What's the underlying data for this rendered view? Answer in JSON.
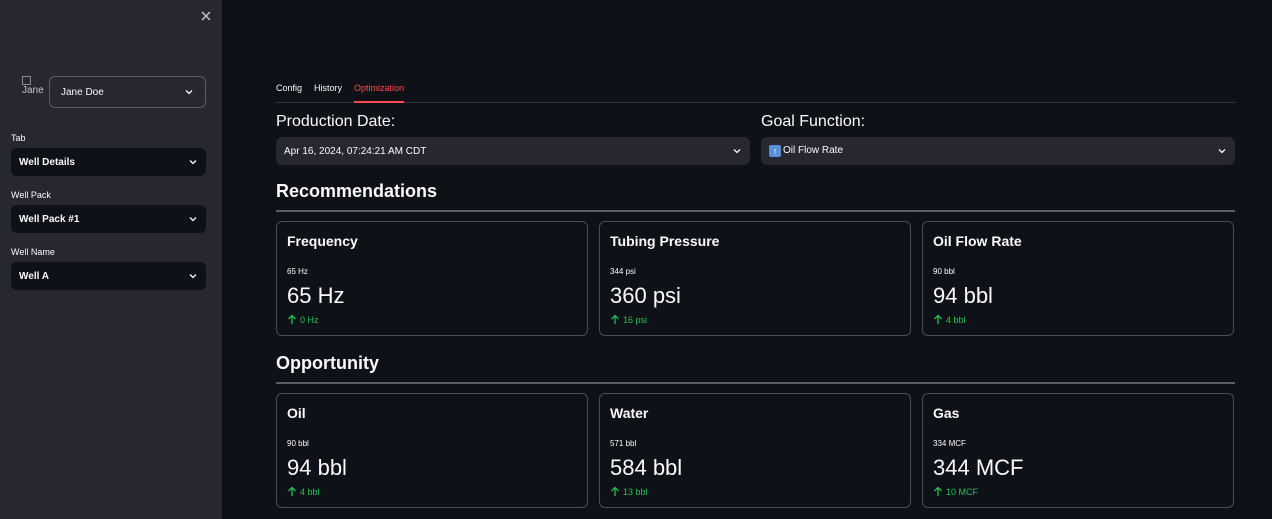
{
  "sidebar": {
    "avatar_alt": "Jane",
    "user": "Jane Doe",
    "tab_label": "Tab",
    "tab_value": "Well Details",
    "wellpack_label": "Well Pack",
    "wellpack_value": "Well Pack #1",
    "wellname_label": "Well Name",
    "wellname_value": "Well A"
  },
  "tabs": [
    "Config",
    "History",
    "Optimization"
  ],
  "active_tab": "Optimization",
  "production_date": {
    "label": "Production Date:",
    "value": "Apr 16, 2024, 07:24:21 AM CDT"
  },
  "goal_function": {
    "label": "Goal Function:",
    "value": "Oil Flow Rate",
    "icon": "up-arrow-emoji-icon"
  },
  "recommendations": {
    "title": "Recommendations",
    "cards": [
      {
        "title": "Frequency",
        "label": "65 Hz",
        "value": "65 Hz",
        "delta": "0 Hz"
      },
      {
        "title": "Tubing Pressure",
        "label": "344 psi",
        "value": "360 psi",
        "delta": "16 psi"
      },
      {
        "title": "Oil Flow Rate",
        "label": "90 bbl",
        "value": "94 bbl",
        "delta": "4 bbl"
      }
    ]
  },
  "opportunity": {
    "title": "Opportunity",
    "cards": [
      {
        "title": "Oil",
        "label": "90 bbl",
        "value": "94 bbl",
        "delta": "4 bbl"
      },
      {
        "title": "Water",
        "label": "571 bbl",
        "value": "584 bbl",
        "delta": "13 bbl"
      },
      {
        "title": "Gas",
        "label": "334 MCF",
        "value": "344 MCF",
        "delta": "10 MCF"
      }
    ]
  },
  "colors": {
    "background": "#0e1117",
    "sidebar": "#262730",
    "accent": "#ff4b4b",
    "delta_positive": "#21c354"
  }
}
